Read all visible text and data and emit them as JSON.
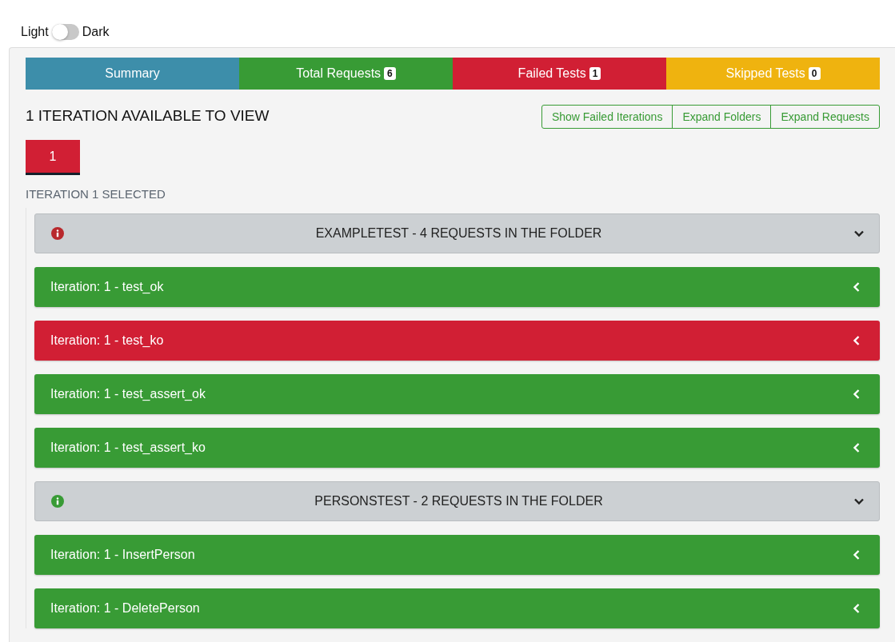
{
  "theme_toggle": {
    "left_label": "Light",
    "right_label": "Dark",
    "on": false
  },
  "tabs": [
    {
      "label": "Summary",
      "color": "#3d8eaa"
    },
    {
      "label": "Total Requests",
      "badge": "6",
      "color": "#389b35"
    },
    {
      "label": "Failed Tests",
      "badge": "1",
      "color": "#d11f34"
    },
    {
      "label": "Skipped Tests",
      "badge": "0",
      "color": "#efb30f"
    }
  ],
  "heading": "1 ITERATION AVAILABLE TO VIEW",
  "actions": [
    "Show Failed Iterations",
    "Expand Folders",
    "Expand Requests"
  ],
  "iterations": [
    {
      "label": "1",
      "selected": true,
      "color": "#d11f34"
    }
  ],
  "selection_label": "ITERATION 1 SELECTED",
  "folders": [
    {
      "title": "EXAMPLETEST - 4 REQUESTS IN THE FOLDER",
      "color": "#b8282c",
      "expanded": true,
      "requests": [
        {
          "label": "Iteration: 1 - test_ok",
          "color": "#389b35",
          "expanded": false
        },
        {
          "label": "Iteration: 1 - test_ko",
          "color": "#d11f34",
          "expanded": false
        },
        {
          "label": "Iteration: 1 - test_assert_ok",
          "color": "#389b35",
          "expanded": false
        },
        {
          "label": "Iteration: 1 - test_assert_ko",
          "color": "#389b35",
          "expanded": false
        }
      ]
    },
    {
      "title": "PERSONSTEST - 2 REQUESTS IN THE FOLDER",
      "color": "#389b35",
      "expanded": true,
      "requests": [
        {
          "label": "Iteration: 1 - InsertPerson",
          "color": "#389b35",
          "expanded": false
        },
        {
          "label": "Iteration: 1 - DeletePerson",
          "color": "#389b35",
          "expanded": false
        }
      ]
    }
  ]
}
